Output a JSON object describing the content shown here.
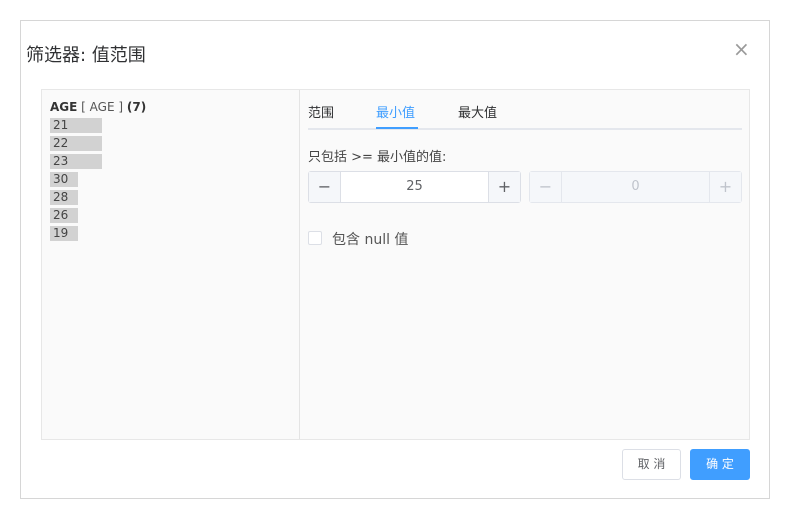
{
  "dialog": {
    "title": "筛选器: 值范围",
    "close_icon": "×"
  },
  "field": {
    "name": "AGE",
    "alias": "[ AGE ]",
    "count": "(7)"
  },
  "values": [
    "21",
    "22",
    "23",
    "30",
    "28",
    "26",
    "19"
  ],
  "tabs": [
    {
      "label": "范围",
      "active": false
    },
    {
      "label": "最小值",
      "active": true
    },
    {
      "label": "最大值",
      "active": false
    }
  ],
  "min_section": {
    "description": "只包括 >= 最小值的值:",
    "min_value": "25",
    "max_value": "0",
    "minus_symbol": "−",
    "plus_symbol": "+"
  },
  "include_null": {
    "label": "包含 null 值",
    "checked": false
  },
  "footer": {
    "cancel": "取 消",
    "ok": "确 定"
  },
  "colors": {
    "accent": "#409eff"
  }
}
